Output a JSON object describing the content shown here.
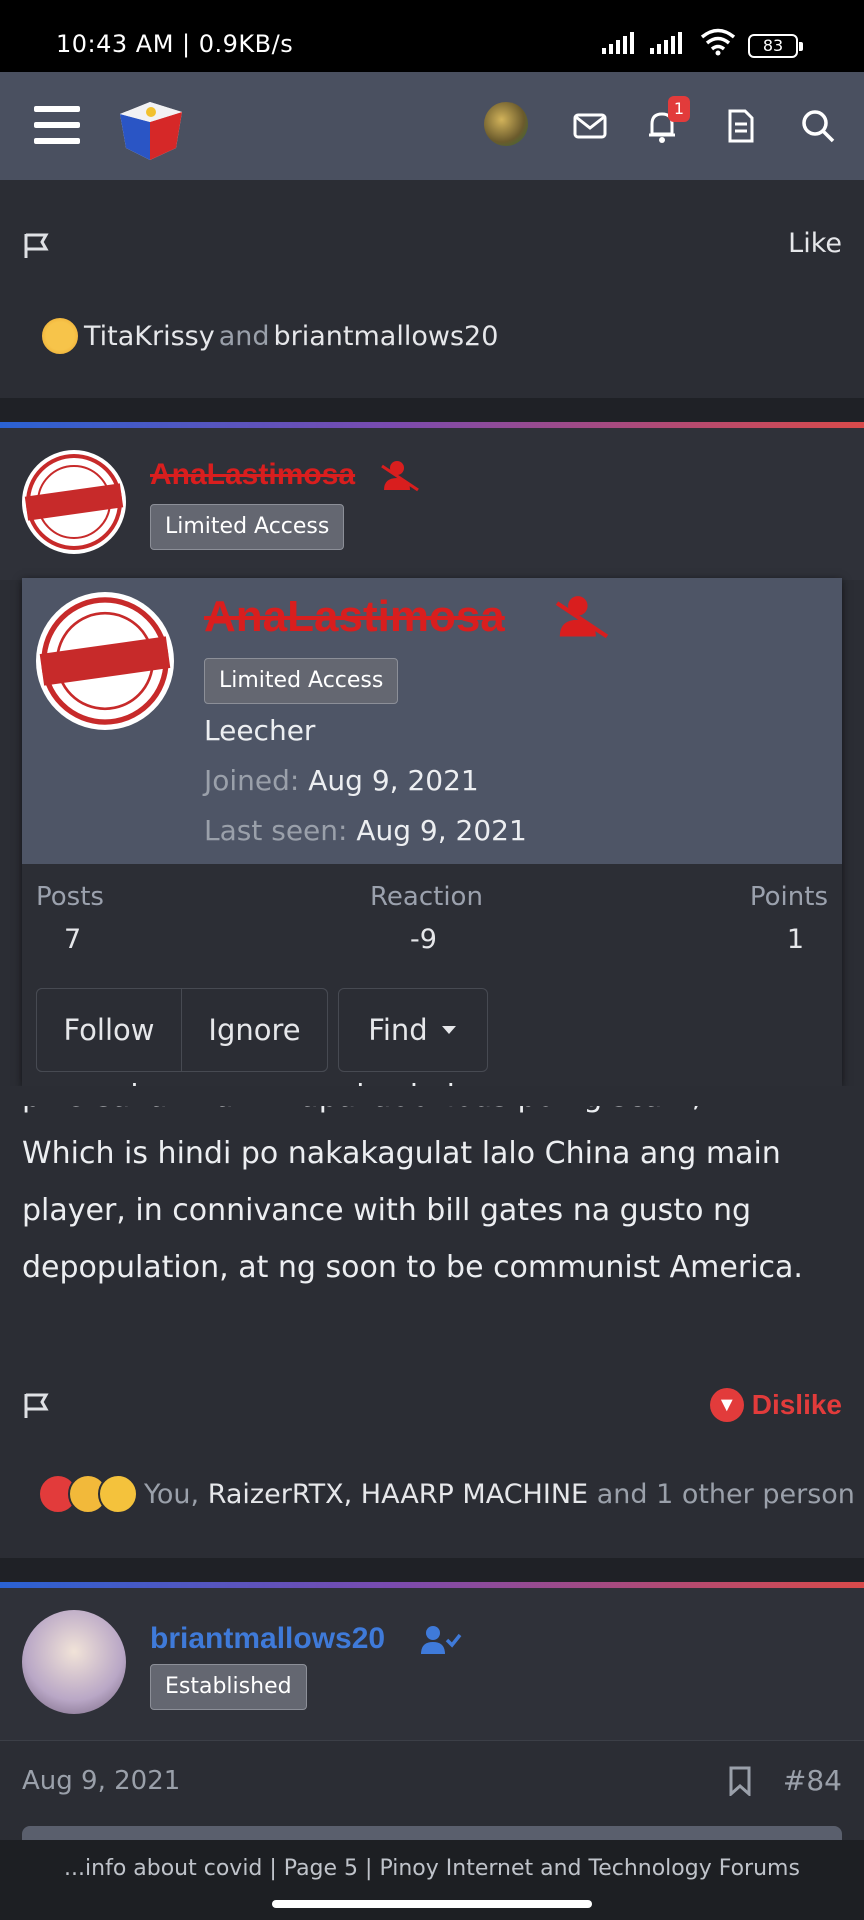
{
  "status_bar": {
    "time_speed": "10:43 AM | 0.9KB/s",
    "battery": "83"
  },
  "nav": {
    "notification_count": "1"
  },
  "prev_post": {
    "like_label": "Like",
    "reactors": {
      "name1": "TitaKrissy",
      "and": "and",
      "name2": "briantmallows20"
    }
  },
  "post": {
    "username": "AnaLastimosa",
    "role_badge": "Limited Access"
  },
  "member_card": {
    "username": "AnaLastimosa",
    "role_badge": "Limited Access",
    "title": "Leecher",
    "joined_label": "Joined:",
    "joined_value": "Aug 9, 2021",
    "last_seen_label": "Last seen:",
    "last_seen_value": "Aug 9, 2021",
    "stats": [
      {
        "label": "Posts",
        "value": "7"
      },
      {
        "label": "Reaction",
        "value": "-9"
      },
      {
        "label": "Points",
        "value": "1"
      }
    ],
    "buttons": {
      "follow": "Follow",
      "ignore": "Ignore",
      "find": "Find"
    }
  },
  "post_body": {
    "line_partial": "pwersahan na ....napakaobvious po ng scam,.",
    "text": "Which is hindi po nakakagulat lalo China ang main player, in connivance with bill gates na gusto ng depopulation, at ng soon to be communist America."
  },
  "post_footer": {
    "dislike_label": "Dislike",
    "reactors": {
      "you": "You,",
      "name1": "RaizerRTX",
      "comma": ",",
      "name2": "HAARP MACHINE",
      "rest": "and 1 other person"
    }
  },
  "next_post": {
    "username": "briantmallows20",
    "role_badge": "Established",
    "date": "Aug 9, 2021",
    "post_number": "#84"
  },
  "bottom": {
    "page_title": "...info about covid | Page 5 | Pinoy Internet and Technology Forums"
  },
  "colors": {
    "banned_red": "#d91e1e",
    "accent_blue": "#3f7ad9",
    "header_bg": "#4a5060"
  }
}
